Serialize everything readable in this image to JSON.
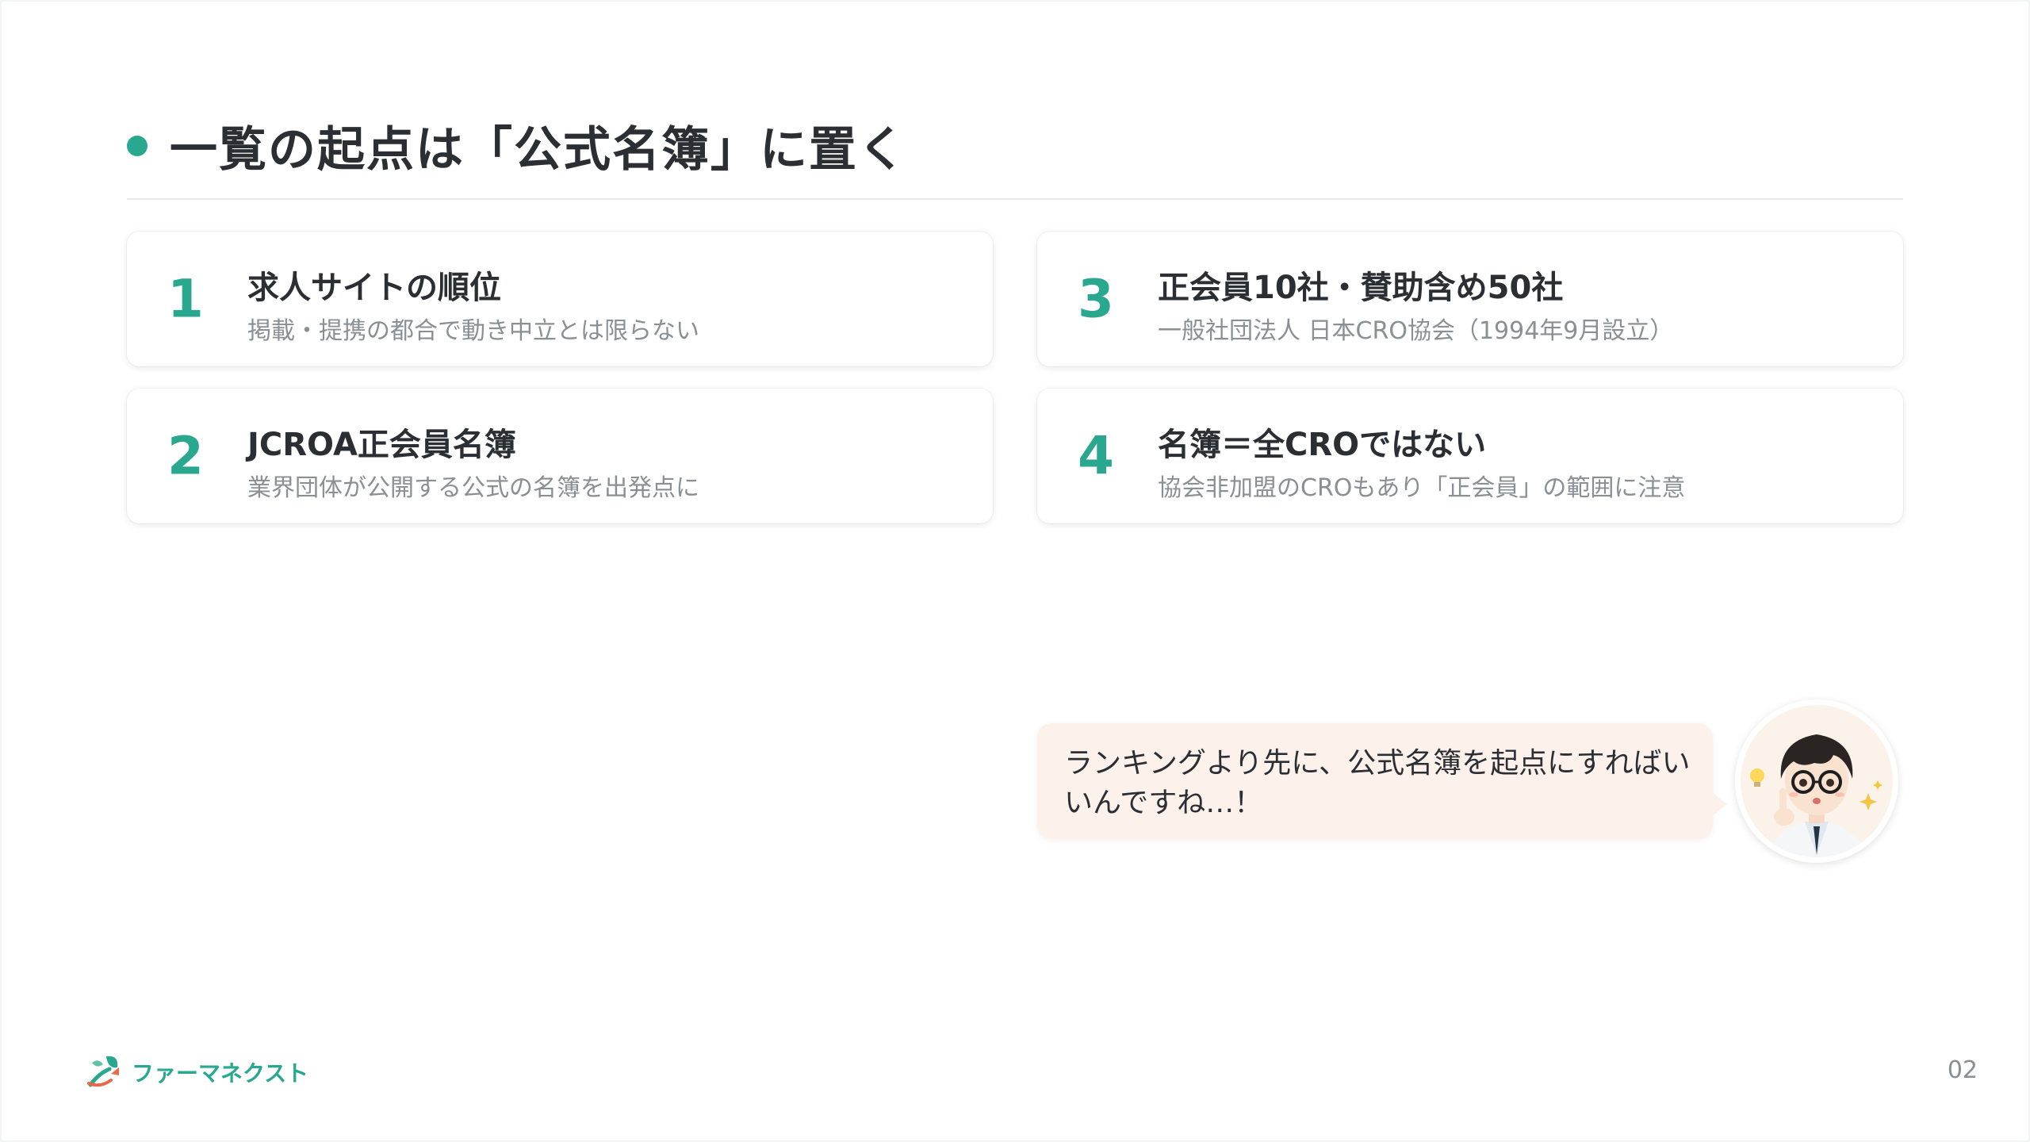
{
  "slide": {
    "title": "一覧の起点は「公式名簿」に置く",
    "accent_color": "#2aa88f",
    "cards": [
      {
        "num": "1",
        "title": "求人サイトの順位",
        "sub": "掲載・提携の都合で動き中立とは限らない"
      },
      {
        "num": "2",
        "title": "JCROA正会員名簿",
        "sub": "業界団体が公開する公式の名簿を出発点に"
      },
      {
        "num": "3",
        "title": "正会員10社・賛助含め50社",
        "sub": "一般社団法人 日本CRO協会（1994年9月設立）"
      },
      {
        "num": "4",
        "title": "名簿＝全CROではない",
        "sub": "協会非加盟のCROもあり「正会員」の範囲に注意"
      }
    ],
    "speech": "ランキングより先に、公式名簿を起点にすればいいんですね…！",
    "avatar_icon": "doctor-character-icon",
    "logo_text": "ファーマネクスト",
    "page_number": "02"
  }
}
